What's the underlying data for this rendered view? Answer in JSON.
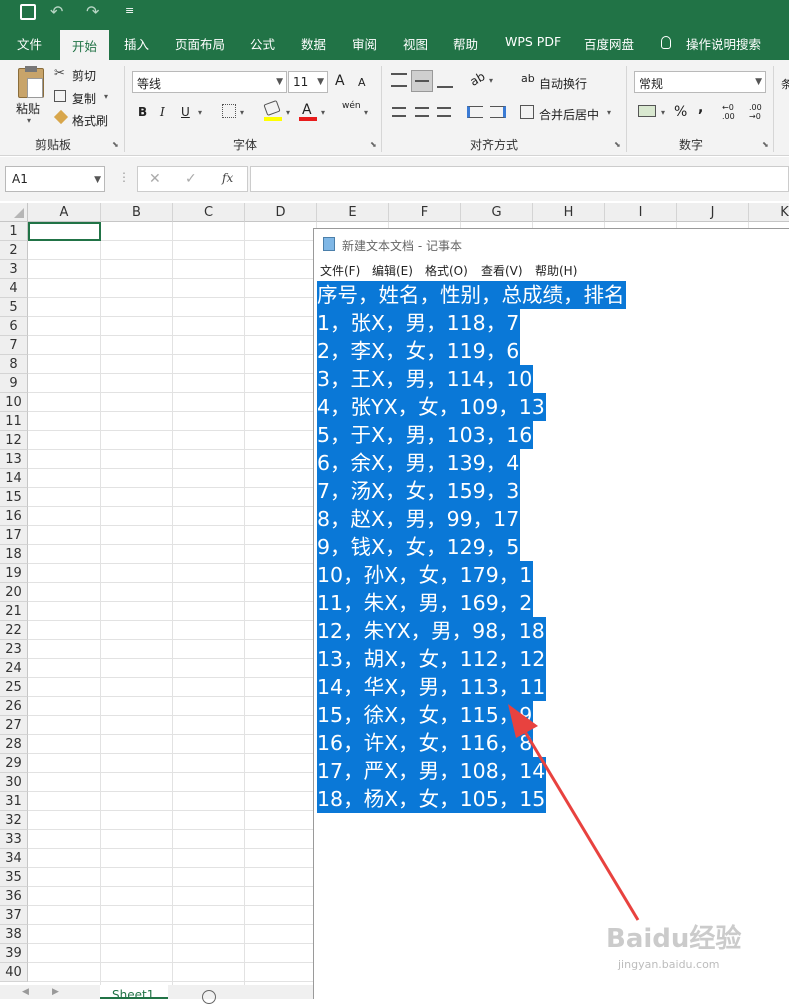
{
  "ribbon_tabs": [
    "文件",
    "开始",
    "插入",
    "页面布局",
    "公式",
    "数据",
    "审阅",
    "视图",
    "帮助",
    "WPS PDF",
    "百度网盘",
    "操作说明搜索"
  ],
  "clipboard": {
    "paste": "粘贴",
    "cut": "剪切",
    "copy": "复制",
    "format_painter": "格式刷",
    "group": "剪贴板"
  },
  "font": {
    "name": "等线",
    "size": "11",
    "bold": "B",
    "italic": "I",
    "underline": "U",
    "group": "字体",
    "grow": "A",
    "shrink": "A",
    "font_color_letter": "A",
    "phonetic": "wén"
  },
  "alignment": {
    "wrap": "自动换行",
    "merge": "合并后居中",
    "group": "对齐方式"
  },
  "number": {
    "format": "常规",
    "percent": "%",
    "comma": ",",
    "group": "数字",
    "more": "条"
  },
  "formula_bar": {
    "name_box": "A1",
    "fx": "fx",
    "cancel": "✕",
    "confirm": "✓"
  },
  "columns": [
    "A",
    "B",
    "C",
    "D",
    "E",
    "F",
    "G",
    "H",
    "I",
    "J",
    "K"
  ],
  "rows": [
    "1",
    "2",
    "3",
    "4",
    "5",
    "6",
    "7",
    "8",
    "9",
    "10",
    "11",
    "12",
    "13",
    "14",
    "15",
    "16",
    "17",
    "18",
    "19",
    "20",
    "21",
    "22",
    "23",
    "24",
    "25",
    "26",
    "27",
    "28",
    "29",
    "30",
    "31",
    "32",
    "33",
    "34",
    "35",
    "36",
    "37",
    "38",
    "39",
    "40"
  ],
  "sheet_tab": "Sheet1",
  "notepad": {
    "title": "新建文本文档 - 记事本",
    "menu": [
      "文件(F)",
      "编辑(E)",
      "格式(O)",
      "查看(V)",
      "帮助(H)"
    ],
    "lines": [
      "序号，姓名，性别，总成绩，排名",
      "1，张X，男，118，7",
      "2，李X，女，119，6",
      "3，王X，男，114，10",
      "4，张YX，女，109，13",
      "5，于X，男，103，16",
      "6，余X，男，139，4",
      "7，汤X，女，159，3",
      "8，赵X，男，99，17",
      "9，钱X，女，129，5",
      "10，孙X，女，179，1",
      "11，朱X，男，169，2",
      "12，朱YX，男，98，18",
      "13，胡X，女，112，12",
      "14，华X，男，113，11",
      "15，徐X，女，115，9",
      "16，许X，女，116，8",
      "17，严X，男，108，14",
      "18，杨X，女，105，15"
    ]
  },
  "watermark": {
    "brand": "Baidu经验",
    "url": "jingyan.baidu.com"
  },
  "colors": {
    "excel_green": "#217346",
    "selection_blue": "#0a78d7",
    "arrow_red": "#e8423f"
  }
}
